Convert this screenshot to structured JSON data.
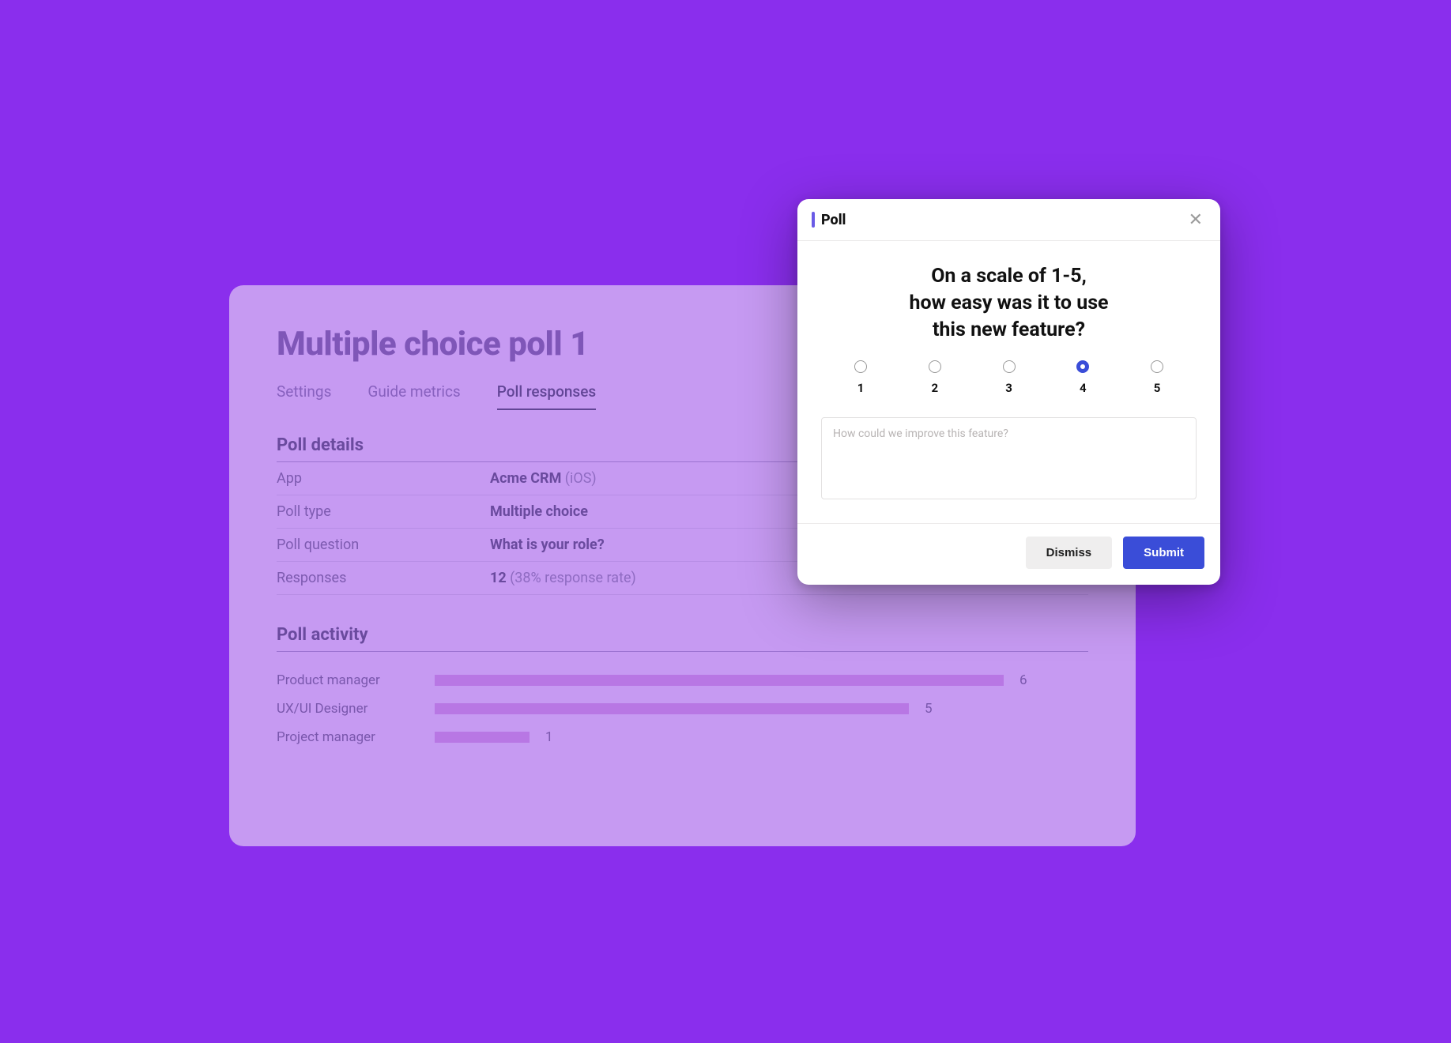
{
  "panel": {
    "title": "Multiple choice poll 1",
    "tabs": {
      "settings": "Settings",
      "guide_metrics": "Guide metrics",
      "poll_responses": "Poll responses"
    },
    "active_tab": "poll_responses",
    "details": {
      "heading": "Poll details",
      "rows": {
        "app": {
          "label": "App",
          "value_bold": "Acme CRM",
          "value_muted": "(iOS)"
        },
        "poll_type": {
          "label": "Poll type",
          "value_bold": "Multiple choice",
          "value_muted": ""
        },
        "poll_question": {
          "label": "Poll question",
          "value_bold": "What is your role?",
          "value_muted": ""
        },
        "responses": {
          "label": "Responses",
          "value_bold": "12",
          "value_muted": "(38% response rate)"
        }
      }
    },
    "activity": {
      "heading": "Poll activity",
      "rows": [
        {
          "label": "Product manager",
          "count": "6"
        },
        {
          "label": "UX/UI Designer",
          "count": "5"
        },
        {
          "label": "Project manager",
          "count": "1"
        }
      ]
    }
  },
  "modal": {
    "title": "Poll",
    "question_line1": "On a scale of 1-5,",
    "question_line2": "how easy was it to use",
    "question_line3": "this new feature?",
    "scale": {
      "min": 1,
      "max": 5,
      "labels": [
        "1",
        "2",
        "3",
        "4",
        "5"
      ],
      "selected": "4"
    },
    "feedback_placeholder": "How could we improve this feature?",
    "buttons": {
      "dismiss": "Dismiss",
      "submit": "Submit"
    }
  },
  "chart_data": {
    "type": "bar",
    "categories": [
      "Product manager",
      "UX/UI Designer",
      "Project manager"
    ],
    "values": [
      6,
      5,
      1
    ],
    "title": "Poll activity",
    "xlabel": "",
    "ylabel": "",
    "ylim": [
      0,
      6
    ]
  }
}
